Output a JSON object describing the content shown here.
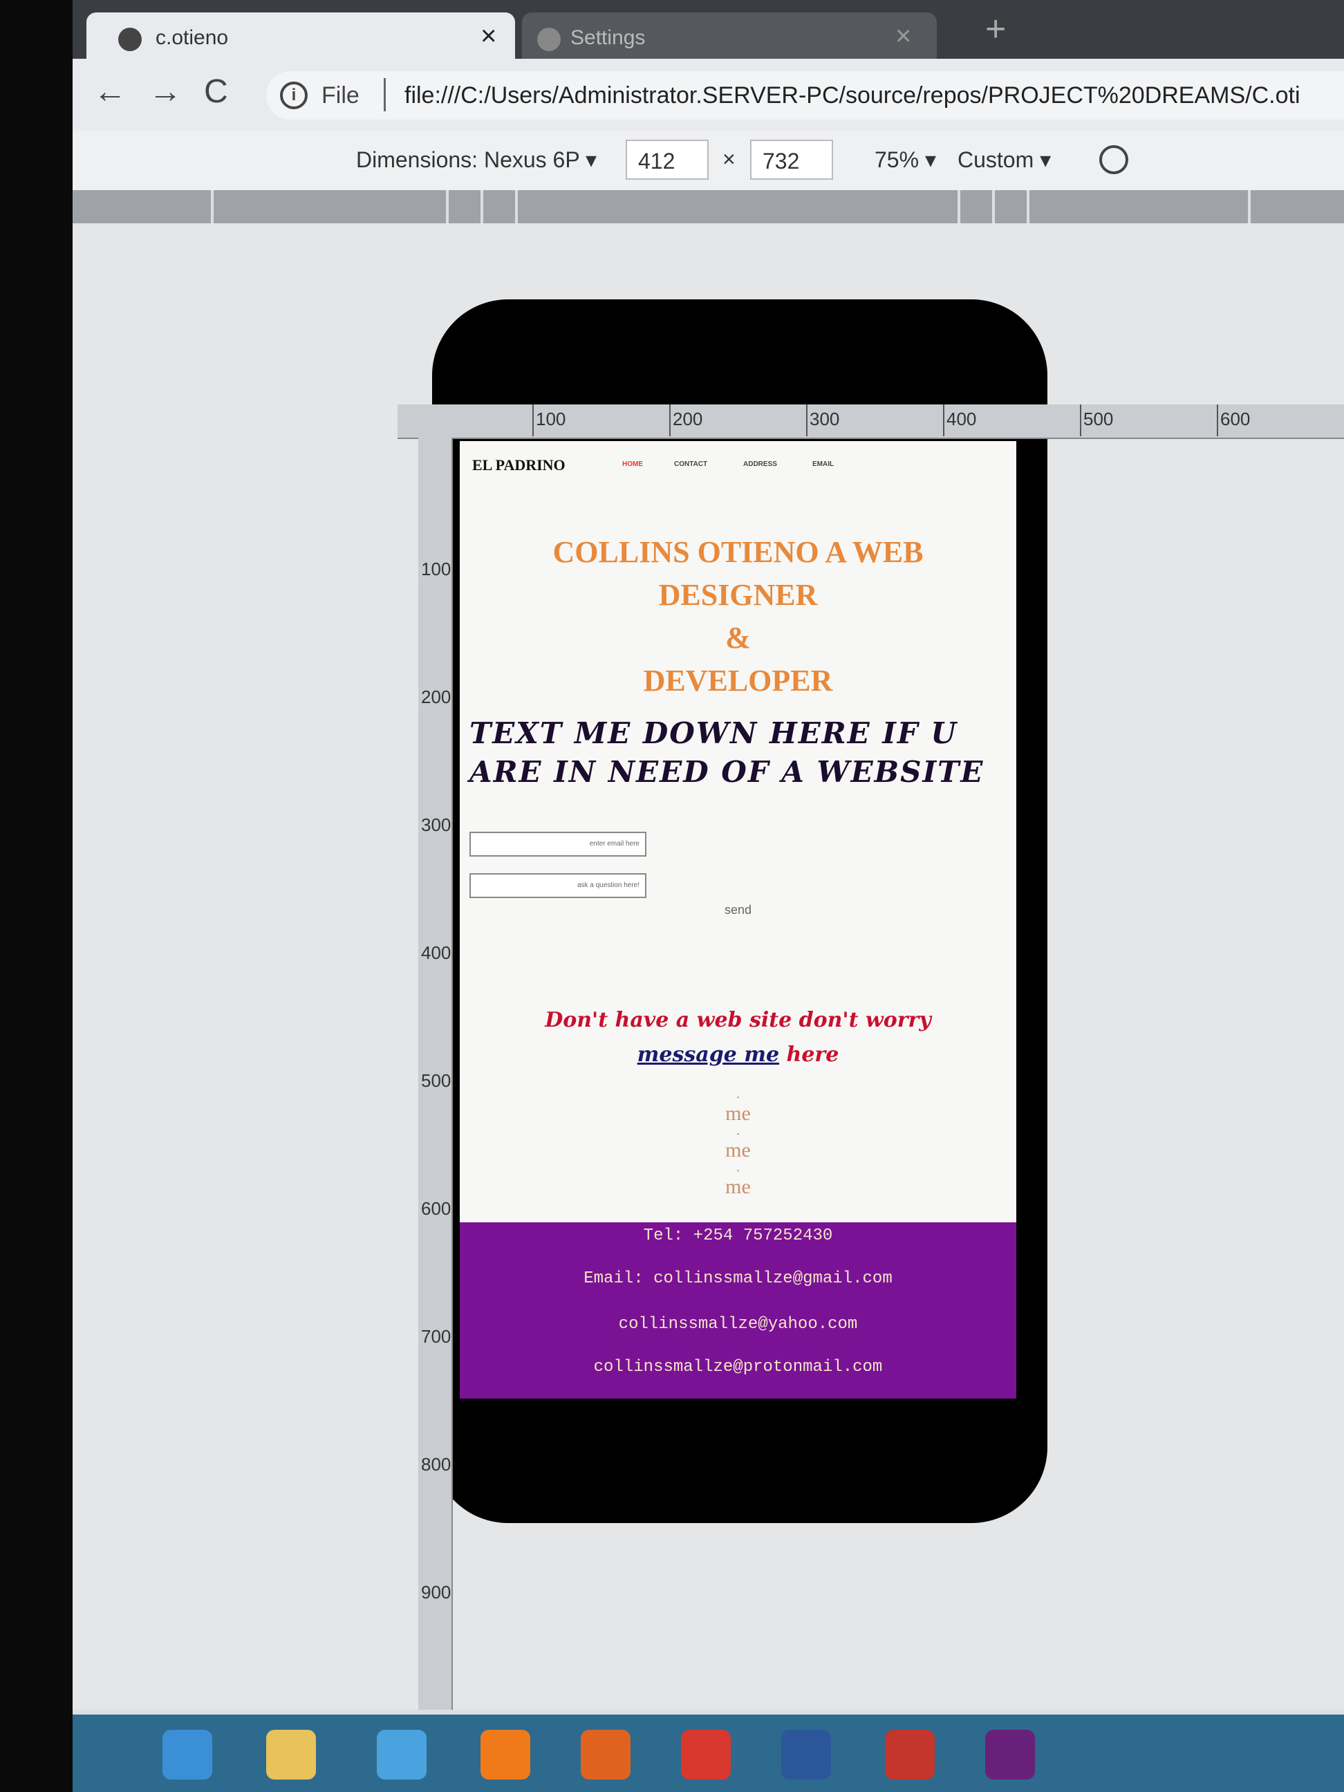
{
  "browser": {
    "tabs": [
      {
        "label": "c.otieno",
        "active": true
      },
      {
        "label": "Settings",
        "active": false
      }
    ],
    "close_glyph": "×",
    "new_tab_glyph": "+",
    "nav": {
      "back": "←",
      "forward": "→",
      "reload": "C"
    },
    "address": {
      "info_glyph": "i",
      "scheme_label": "File",
      "url": "file:///C:/Users/Administrator.SERVER-PC/source/repos/PROJECT%20DREAMS/C.oti"
    }
  },
  "device_toolbar": {
    "dimensions_label": "Dimensions: Nexus 6P ▾",
    "width": "412",
    "height": "732",
    "times": "×",
    "zoom": "75% ▾",
    "throttle": "Custom ▾"
  },
  "rulers": {
    "top_labels": [
      "100",
      "200",
      "300",
      "400",
      "500",
      "600"
    ],
    "left_labels": [
      "100",
      "200",
      "300",
      "400",
      "500",
      "600",
      "700",
      "800",
      "900"
    ]
  },
  "site": {
    "brand": "EL PADRINO",
    "nav": [
      "HOME",
      "CONTACT",
      "ADDRESS",
      "EMAIL"
    ],
    "hero": [
      "COLLINS OTIENO A WEB",
      "DESIGNER",
      "&",
      "DEVELOPER"
    ],
    "cta": "TEXT ME DOWN HERE IF U ARE IN NEED OF A WEBSITE",
    "email_placeholder": "enter email here",
    "question_placeholder": "ask a question here!",
    "send_label": "send",
    "promo_line1": "Don't have a web site don't worry",
    "promo_link": "message me",
    "promo_tail": "here",
    "me_items": [
      "me",
      "me",
      "me"
    ],
    "bullet": "•",
    "footer": {
      "tel": "Tel: +254 757252430",
      "email": "Email: collinssmallze@gmail.com",
      "email2": "collinssmallze@yahoo.com",
      "email3": "collinssmallze@protonmail.com"
    }
  },
  "taskbar": {
    "apps": [
      "windows-start",
      "file-explorer",
      "internet-explorer",
      "vlc",
      "media-player",
      "chrome",
      "word",
      "chrome-alt",
      "visual-studio"
    ]
  },
  "colors": {
    "hero": "#e8893b",
    "footer_bg": "#7a1295",
    "promo": "#c8102e",
    "link": "#1a1a6e"
  }
}
